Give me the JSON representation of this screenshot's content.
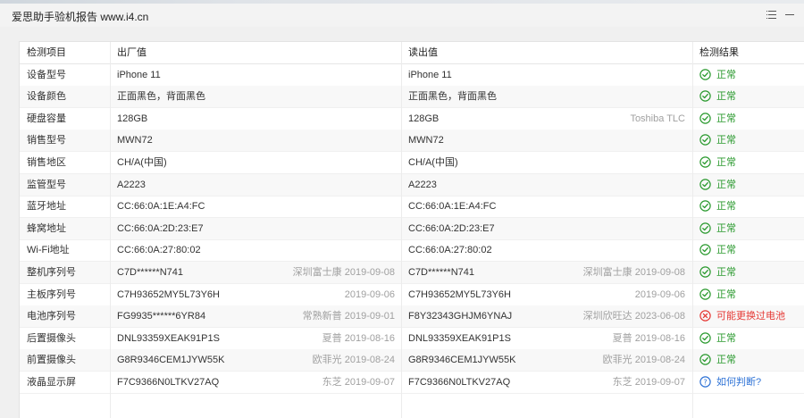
{
  "window": {
    "title": "爱思助手验机报告 www.i4.cn"
  },
  "colors": {
    "ok": "#2b9a2f",
    "bad": "#e53935",
    "ask": "#2f73d6"
  },
  "table": {
    "headers": [
      "检测项目",
      "出厂值",
      "读出值",
      "检测结果"
    ],
    "rows": [
      {
        "item": "设备型号",
        "factory": "iPhone 11",
        "factory_meta": "",
        "read": "iPhone 11",
        "read_meta": "",
        "result": "正常",
        "status": "ok"
      },
      {
        "item": "设备颜色",
        "factory": "正面黑色，背面黑色",
        "factory_meta": "",
        "read": "正面黑色，背面黑色",
        "read_meta": "",
        "result": "正常",
        "status": "ok"
      },
      {
        "item": "硬盘容量",
        "factory": "128GB",
        "factory_meta": "",
        "read": "128GB",
        "read_meta": "Toshiba TLC",
        "result": "正常",
        "status": "ok"
      },
      {
        "item": "销售型号",
        "factory": "MWN72",
        "factory_meta": "",
        "read": "MWN72",
        "read_meta": "",
        "result": "正常",
        "status": "ok"
      },
      {
        "item": "销售地区",
        "factory": "CH/A(中国)",
        "factory_meta": "",
        "read": "CH/A(中国)",
        "read_meta": "",
        "result": "正常",
        "status": "ok"
      },
      {
        "item": "监管型号",
        "factory": "A2223",
        "factory_meta": "",
        "read": "A2223",
        "read_meta": "",
        "result": "正常",
        "status": "ok"
      },
      {
        "item": "蓝牙地址",
        "factory": "CC:66:0A:1E:A4:FC",
        "factory_meta": "",
        "read": "CC:66:0A:1E:A4:FC",
        "read_meta": "",
        "result": "正常",
        "status": "ok"
      },
      {
        "item": "蜂窝地址",
        "factory": "CC:66:0A:2D:23:E7",
        "factory_meta": "",
        "read": "CC:66:0A:2D:23:E7",
        "read_meta": "",
        "result": "正常",
        "status": "ok"
      },
      {
        "item": "Wi-Fi地址",
        "factory": "CC:66:0A:27:80:02",
        "factory_meta": "",
        "read": "CC:66:0A:27:80:02",
        "read_meta": "",
        "result": "正常",
        "status": "ok"
      },
      {
        "item": "整机序列号",
        "factory": "C7D******N741",
        "factory_meta": "深圳富士康 2019-09-08",
        "read": "C7D******N741",
        "read_meta": "深圳富士康 2019-09-08",
        "result": "正常",
        "status": "ok"
      },
      {
        "item": "主板序列号",
        "factory": "C7H93652MY5L73Y6H",
        "factory_meta": "2019-09-06",
        "read": "C7H93652MY5L73Y6H",
        "read_meta": "2019-09-06",
        "result": "正常",
        "status": "ok"
      },
      {
        "item": "电池序列号",
        "factory": "FG9935******6YR84",
        "factory_meta": "常熟新普 2019-09-01",
        "read": "F8Y32343GHJM6YNAJ",
        "read_meta": "深圳欣旺达 2023-06-08",
        "result": "可能更换过电池",
        "status": "bad"
      },
      {
        "item": "后置摄像头",
        "factory": "DNL93359XEAK91P1S",
        "factory_meta": "夏普 2019-08-16",
        "read": "DNL93359XEAK91P1S",
        "read_meta": "夏普 2019-08-16",
        "result": "正常",
        "status": "ok"
      },
      {
        "item": "前置摄像头",
        "factory": "G8R9346CEM1JYW55K",
        "factory_meta": "欧菲光 2019-08-24",
        "read": "G8R9346CEM1JYW55K",
        "read_meta": "欧菲光 2019-08-24",
        "result": "正常",
        "status": "ok"
      },
      {
        "item": "液晶显示屏",
        "factory": "F7C9366N0LTKV27AQ",
        "factory_meta": "东芝 2019-09-07",
        "read": "F7C9366N0LTKV27AQ",
        "read_meta": "东芝 2019-09-07",
        "result": "如何判断?",
        "status": "ask"
      }
    ]
  }
}
